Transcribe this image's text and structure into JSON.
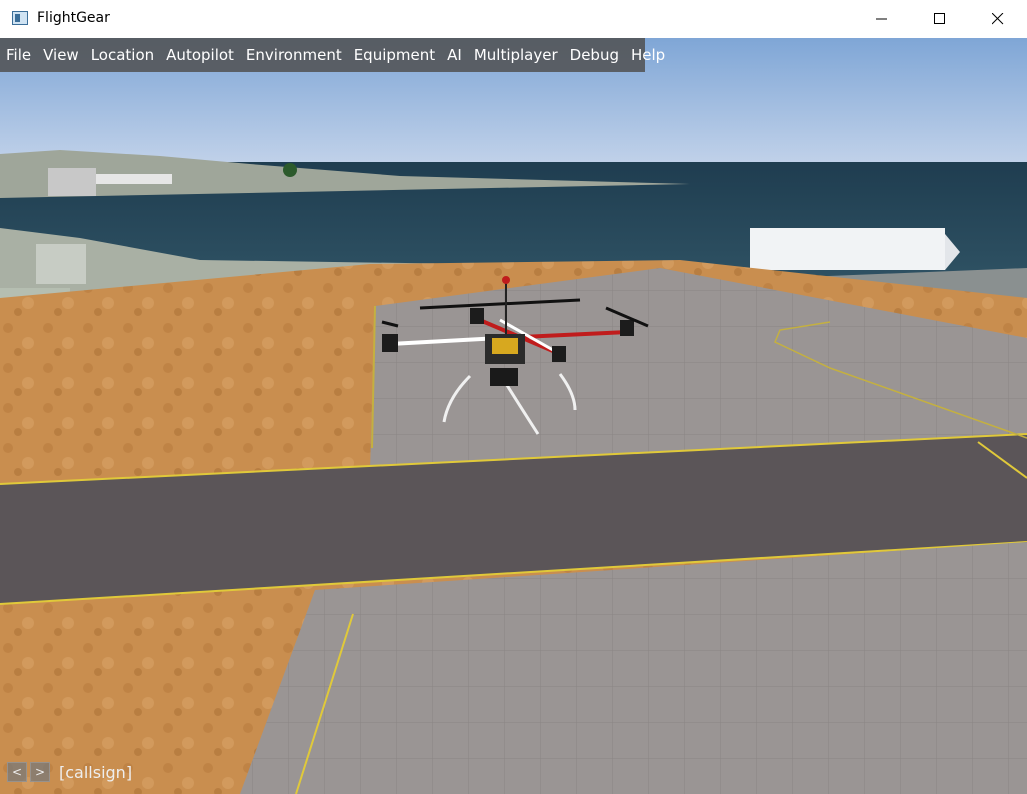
{
  "window": {
    "title": "FlightGear",
    "app_icon": "window-app-icon",
    "controls": [
      "minimize-icon",
      "maximize-icon",
      "close-icon"
    ]
  },
  "menubar": {
    "items": [
      "File",
      "View",
      "Location",
      "Autopilot",
      "Environment",
      "Equipment",
      "AI",
      "Multiplayer",
      "Debug",
      "Help"
    ]
  },
  "multiplayer": {
    "prev_label": "<",
    "next_label": ">",
    "callsign": "[callsign]"
  },
  "colors": {
    "sky_top": "#7fa6d6",
    "sea": "#27495a",
    "sand": "#c98e4f",
    "tarmac": "#9a9594",
    "taxiway": "#5b5558",
    "marking": "#e0c93a",
    "drone_red": "#c01c1c"
  }
}
